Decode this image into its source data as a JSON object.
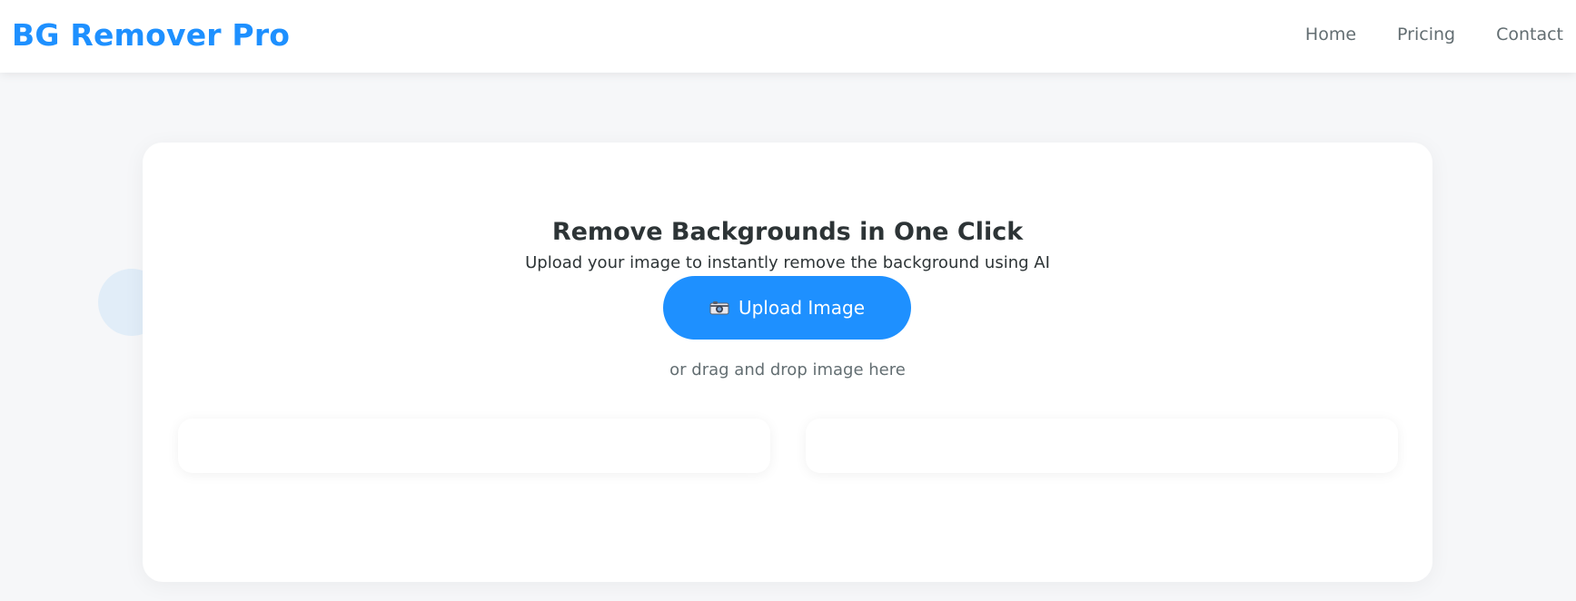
{
  "header": {
    "brand": "BG Remover Pro",
    "nav": {
      "home": "Home",
      "pricing": "Pricing",
      "contact": "Contact"
    }
  },
  "hero": {
    "title": "Remove Backgrounds in One Click",
    "subtitle": "Upload your image to instantly remove the background using AI",
    "upload_button": {
      "icon": "camera-icon",
      "label": "Upload Image"
    },
    "drop_hint": "or drag and drop image here"
  },
  "colors": {
    "accent": "#1e90ff",
    "page_background": "#f6f7f9",
    "heading_text": "#2d3436",
    "muted_text": "#636e72"
  }
}
